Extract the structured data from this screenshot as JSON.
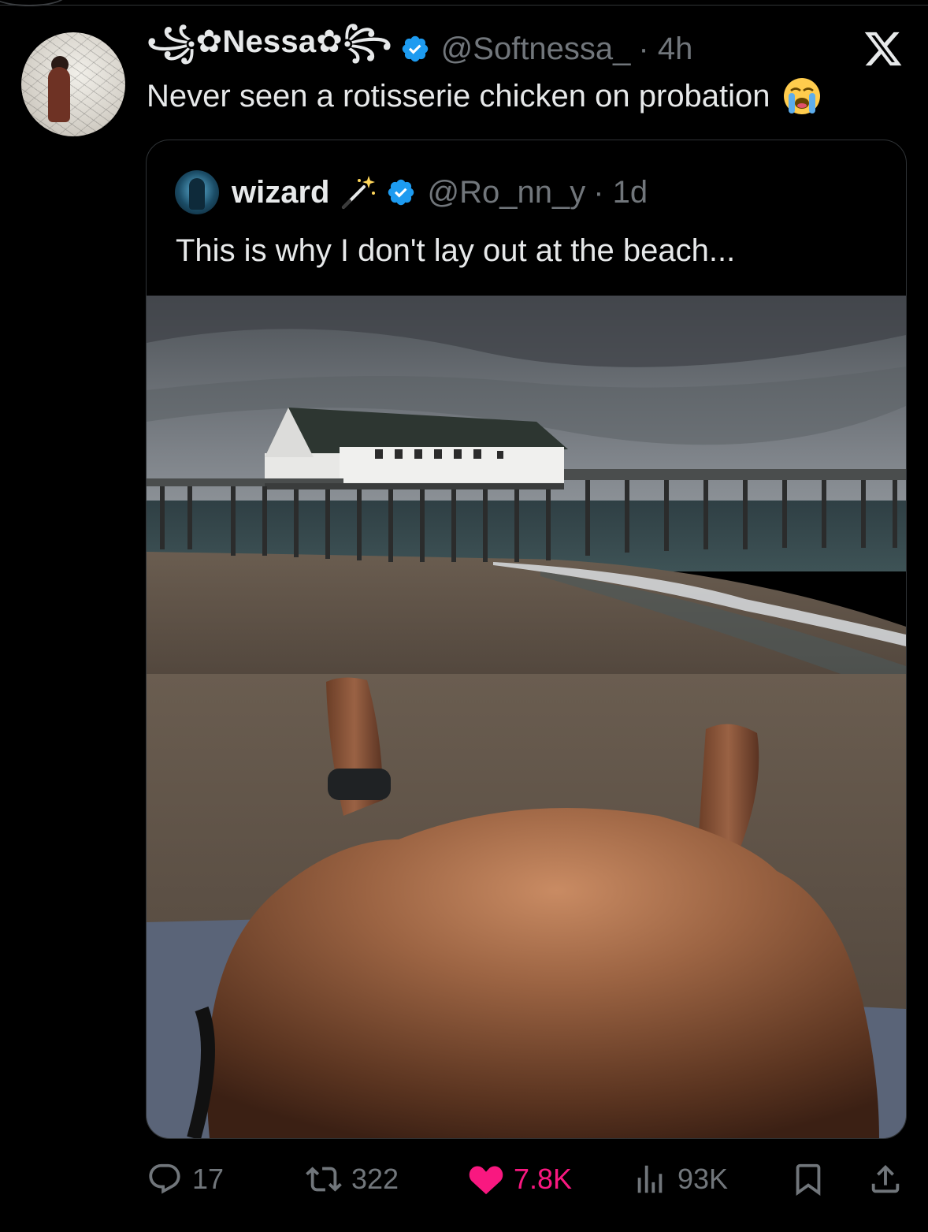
{
  "tweet": {
    "display_name": "꧁✿Nessa✿꧂",
    "handle": "@Softnessa_",
    "time": "· 4h",
    "text": "Never seen a rotisserie chicken on probation",
    "emoji": "loudly-crying-face"
  },
  "quoted": {
    "display_name": "wizard",
    "name_emoji": "magic-wand",
    "handle": "@Ro_nn_y",
    "time": "· 1d",
    "text": "This is why I don't lay out at the beach...",
    "media": "beach-pier-photo"
  },
  "actions": {
    "replies": "17",
    "reposts": "322",
    "likes": "7.8K",
    "views": "93K"
  },
  "colors": {
    "background": "#000000",
    "text": "#e7e9ea",
    "muted": "#71767b",
    "verified": "#1d9bf0",
    "like": "#f91880",
    "border": "#2f3336"
  },
  "icons": [
    "verified-badge-icon",
    "x-logo-icon",
    "reply-icon",
    "repost-icon",
    "like-icon",
    "views-icon",
    "bookmark-icon",
    "share-icon"
  ]
}
